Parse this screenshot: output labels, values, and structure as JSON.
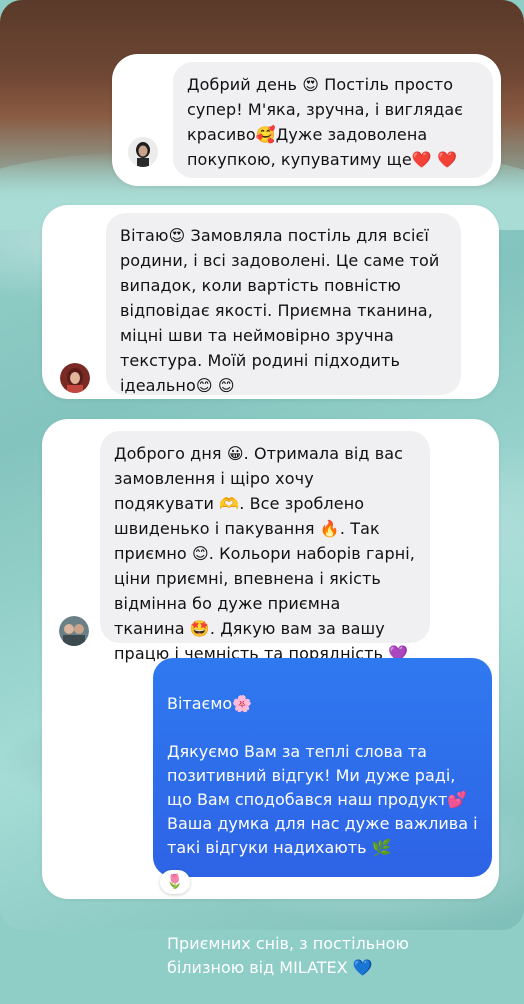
{
  "messages": [
    {
      "text": "Добрий день 😍 Постіль просто супер! М'яка, зручна, і виглядає красиво🥰Дуже задоволена покупкою, купуватиму ще❤️ ❤️",
      "avatar_icon": "user-avatar"
    },
    {
      "text": "Вітаю😍 Замовляла постіль для всієї родини, і всі задоволені. Це саме той випадок, коли вартість повністю відповідає якості. Приємна тканина, міцні шви та неймовірно зручна текстура. Моїй родині підходить ідеально😊 😊",
      "avatar_icon": "user-avatar"
    },
    {
      "text": "Доброго дня 😀. Отримала від вас замовлення і щіро хочу подякувати 🫶. Все зроблено швиденько і пакування 🔥. Так приємно 😊. Кольори наборів гарні, ціни приємні, впевнена і якість відмінна бо дуже приємна тканина 🤩. Дякую вам за вашу працю і чемність та порядність 💜",
      "avatar_icon": "user-avatar"
    }
  ],
  "reply": {
    "greeting": "Вітаємо🌸",
    "body": "Дякуємо Вам за теплі слова та позитивний відгук! Ми дуже раді, що Вам сподобався наш продукт💕 Ваша думка для нас дуже важлива і такі відгуки надихають 🌿",
    "closing": "Приємних снів,  з постільною білизною від MILATEX 💙",
    "reaction": "🌷"
  },
  "colors": {
    "reply_bubble": "#2f6fea",
    "incoming_bubble": "#f0f0f2",
    "card": "#ffffff"
  }
}
